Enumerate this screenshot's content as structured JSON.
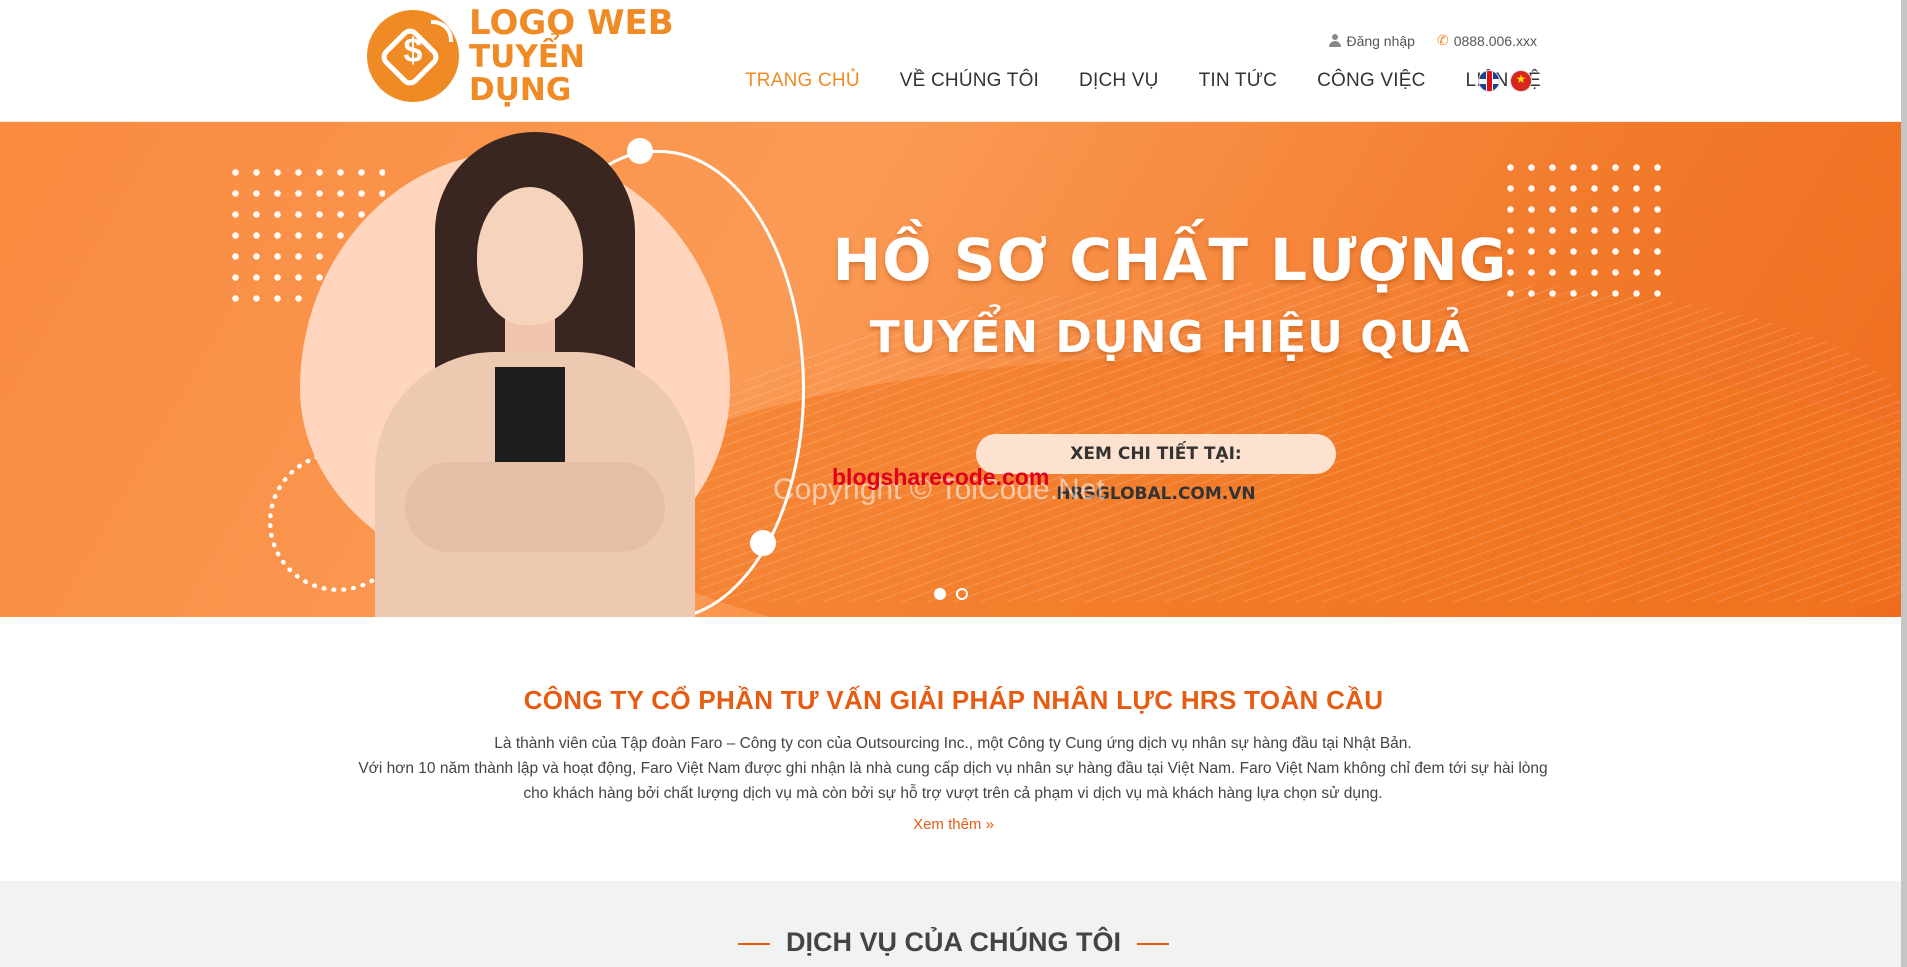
{
  "header": {
    "logo_line1": "LOGO WEB",
    "logo_line2": "TUYỂN DỤNG",
    "logo_icon_symbol": "$",
    "login_label": "Đăng nhập",
    "phone": "0888.006.xxx",
    "nav": [
      {
        "label": "TRANG CHỦ",
        "active": true
      },
      {
        "label": "VỀ CHÚNG TÔI",
        "active": false
      },
      {
        "label": "DỊCH VỤ",
        "active": false
      },
      {
        "label": "TIN TỨC",
        "active": false
      },
      {
        "label": "CÔNG VIỆC",
        "active": false
      },
      {
        "label": "LIÊN HỆ",
        "active": false
      }
    ],
    "languages": [
      "English",
      "Tiếng Việt"
    ]
  },
  "banner": {
    "headline_line1": "HỒ SƠ CHẤT LƯỢNG",
    "headline_line2": "TUYỂN DỤNG HIỆU QUẢ",
    "cta": "XEM CHI TIẾT TẠI: HRSGLOBAL.COM.VN",
    "watermark_red": "blogsharecode.com",
    "watermark_grey": "Copyright © ToiCode.Net",
    "slides_total": 2,
    "active_slide": 1
  },
  "about": {
    "title": "CÔNG TY CỔ PHẦN TƯ VẤN GIẢI PHÁP NHÂN LỰC HRS TOÀN CẦU",
    "line1": "Là thành viên của Tập đoàn Faro – Công ty con của Outsourcing Inc., một Công ty Cung ứng dịch vụ nhân sự hàng đầu tại Nhật Bản.",
    "line2": "Với hơn 10 năm thành lập và hoạt động, Faro Việt Nam được ghi nhận là nhà cung cấp dịch vụ nhân sự hàng đầu tại Việt Nam. Faro Việt Nam không chỉ đem tới sự hài lòng",
    "line3": "cho khách hàng bởi chất lượng dịch vụ mà còn bởi sự hỗ trợ vượt trên cả phạm vi dịch vụ mà khách hàng lựa chọn sử dụng.",
    "more_link": "Xem thêm »"
  },
  "services": {
    "title": "DỊCH VỤ CỦA CHÚNG TÔI"
  },
  "colors": {
    "accent": "#f08a24",
    "title_orange": "#e65c12",
    "banner_orange": "#f98a3f"
  }
}
